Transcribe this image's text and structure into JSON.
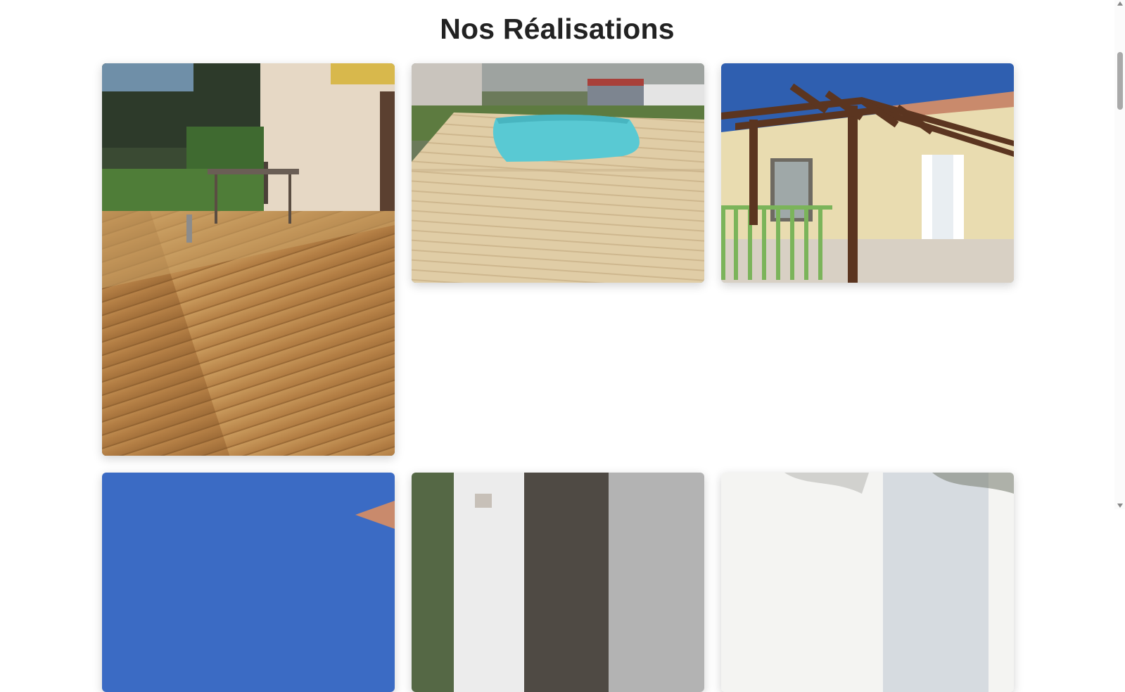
{
  "page": {
    "title": "Nos Réalisations"
  },
  "gallery": {
    "items": [
      {
        "subject": "wooden deck terrace with patio furniture",
        "icon": "photo-icon"
      },
      {
        "subject": "wooden pool deck",
        "icon": "photo-icon"
      },
      {
        "subject": "wooden pergola by house",
        "icon": "photo-icon"
      },
      {
        "subject": "house roof under blue sky",
        "icon": "photo-icon"
      },
      {
        "subject": "window with plants",
        "icon": "photo-icon"
      },
      {
        "subject": "facade with shutters and shadows",
        "icon": "photo-icon"
      }
    ]
  },
  "colors": {
    "title": "#222222",
    "scroll_thumb": "#a9a9a9"
  }
}
